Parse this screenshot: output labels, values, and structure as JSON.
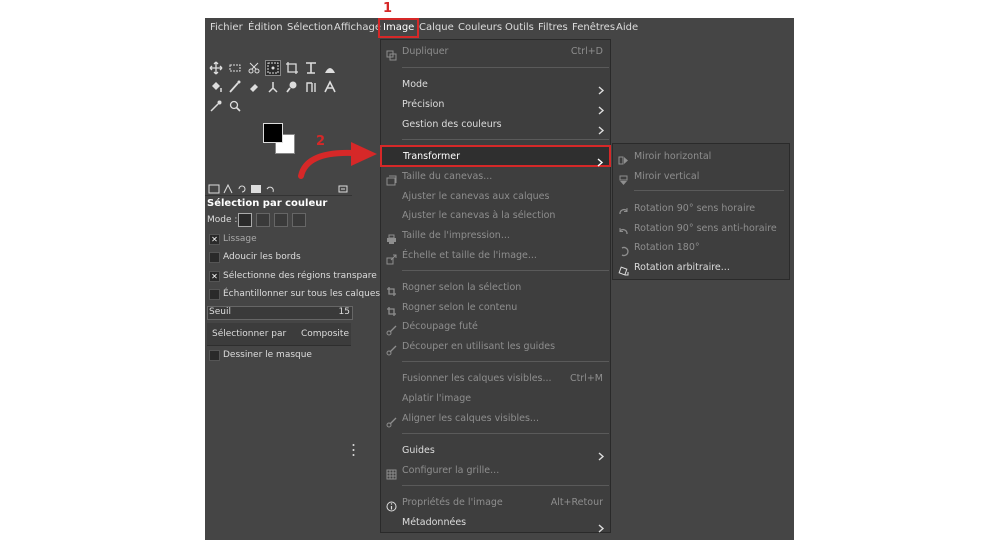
{
  "menubar": {
    "items": [
      "Fichier",
      "Édition",
      "Sélection",
      "Affichage",
      "Image",
      "Calque",
      "Couleurs",
      "Outils",
      "Filtres",
      "Fenêtres",
      "Aide"
    ]
  },
  "toolbox": {
    "icons": [
      "move-icon",
      "rect-select-icon",
      "scissors-select-icon",
      "color-select-icon",
      "crop-icon",
      "text-transform-icon",
      "warp-icon",
      "bucket-fill-icon",
      "paintbrush-icon",
      "eraser-icon",
      "clone-icon",
      "smudge-icon",
      "path-icon",
      "text-tool-icon",
      "color-picker-icon",
      "zoom-icon"
    ]
  },
  "tool_options": {
    "title": "Sélection par couleur",
    "mode_label": "Mode :",
    "usage": "Lissage",
    "soften_edges": "Adoucir les bords",
    "select_transparent": "Sélectionne des régions transpare",
    "sample_merged": "Échantillonner sur tous les calques",
    "threshold_label": "Seuil",
    "threshold_value": "15",
    "select_by_label": "Sélectionner par",
    "select_by_value": "Composite",
    "draw_mask": "Dessiner le masque",
    "checked": {
      "usage": true,
      "soften_edges": false,
      "select_transparent": true,
      "sample_merged": false,
      "draw_mask": false
    }
  },
  "image_menu": {
    "duplicate": "Dupliquer",
    "duplicate_sc": "Ctrl+D",
    "mode": "Mode",
    "precision": "Précision",
    "color_management": "Gestion des couleurs",
    "transform": "Transformer",
    "canvas_size": "Taille du canevas...",
    "fit_canvas_layers": "Ajuster le canevas aux calques",
    "fit_canvas_selection": "Ajuster le canevas à la sélection",
    "print_size": "Taille de l'impression...",
    "scale_image": "Échelle et taille de l'image...",
    "crop_selection": "Rogner selon la sélection",
    "crop_content": "Rogner selon le contenu",
    "guillotine": "Découpage futé",
    "slice_guides": "Découper en utilisant les guides",
    "merge_layers": "Fusionner les calques visibles...",
    "merge_layers_sc": "Ctrl+M",
    "flatten": "Aplatir l'image",
    "align_layers": "Aligner les calques visibles...",
    "guides": "Guides",
    "configure_grid": "Configurer la grille...",
    "image_properties": "Propriétés de l'image",
    "image_properties_sc": "Alt+Retour",
    "metadata": "Métadonnées"
  },
  "transform_submenu": {
    "flip_horizontal": "Miroir horizontal",
    "flip_vertical": "Miroir vertical",
    "rotate_cw": "Rotation 90° sens horaire",
    "rotate_ccw": "Rotation 90° sens anti-horaire",
    "rotate_180": "Rotation 180°",
    "arbitrary_rotation": "Rotation arbitraire..."
  },
  "annotations": {
    "step1": "1",
    "step2": "2"
  },
  "colors": {
    "accent_red": "#d62828",
    "menu_bg": "#3e3e3e",
    "app_bg": "#454545"
  }
}
